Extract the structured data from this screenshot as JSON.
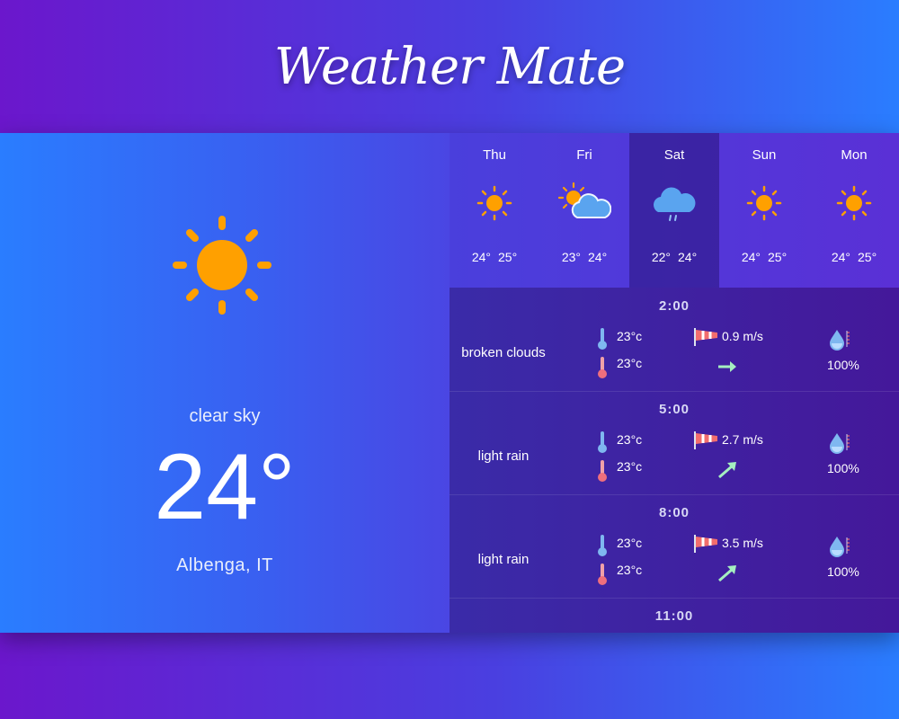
{
  "app": {
    "title": "Weather Mate"
  },
  "current": {
    "condition": "clear sky",
    "temperature": "24°",
    "location": "Albenga, IT",
    "icon": "sun-icon"
  },
  "forecast": [
    {
      "day": "Thu",
      "icon": "sun-icon",
      "min": "24°",
      "max": "25°"
    },
    {
      "day": "Fri",
      "icon": "partly-cloudy-icon",
      "min": "23°",
      "max": "24°"
    },
    {
      "day": "Sat",
      "icon": "rain-cloud-icon",
      "min": "22°",
      "max": "24°",
      "selected": true
    },
    {
      "day": "Sun",
      "icon": "sun-icon",
      "min": "24°",
      "max": "25°"
    },
    {
      "day": "Mon",
      "icon": "sun-icon",
      "min": "24°",
      "max": "25°"
    }
  ],
  "hourly": [
    {
      "time": "2:00",
      "description": "broken clouds",
      "temp_max": "23°c",
      "temp_min": "23°c",
      "wind": "0.9 m/s",
      "wind_direction": "east",
      "humidity": "100%"
    },
    {
      "time": "5:00",
      "description": "light rain",
      "temp_max": "23°c",
      "temp_min": "23°c",
      "wind": "2.7 m/s",
      "wind_direction": "north-east",
      "humidity": "100%"
    },
    {
      "time": "8:00",
      "description": "light rain",
      "temp_max": "23°c",
      "temp_min": "23°c",
      "wind": "3.5 m/s",
      "wind_direction": "north-east",
      "humidity": "100%"
    },
    {
      "time": "11:00"
    }
  ],
  "colors": {
    "sun": "#ffa000",
    "cloud": "#5aa4ef",
    "wind_arrow": "#a5efc0"
  }
}
